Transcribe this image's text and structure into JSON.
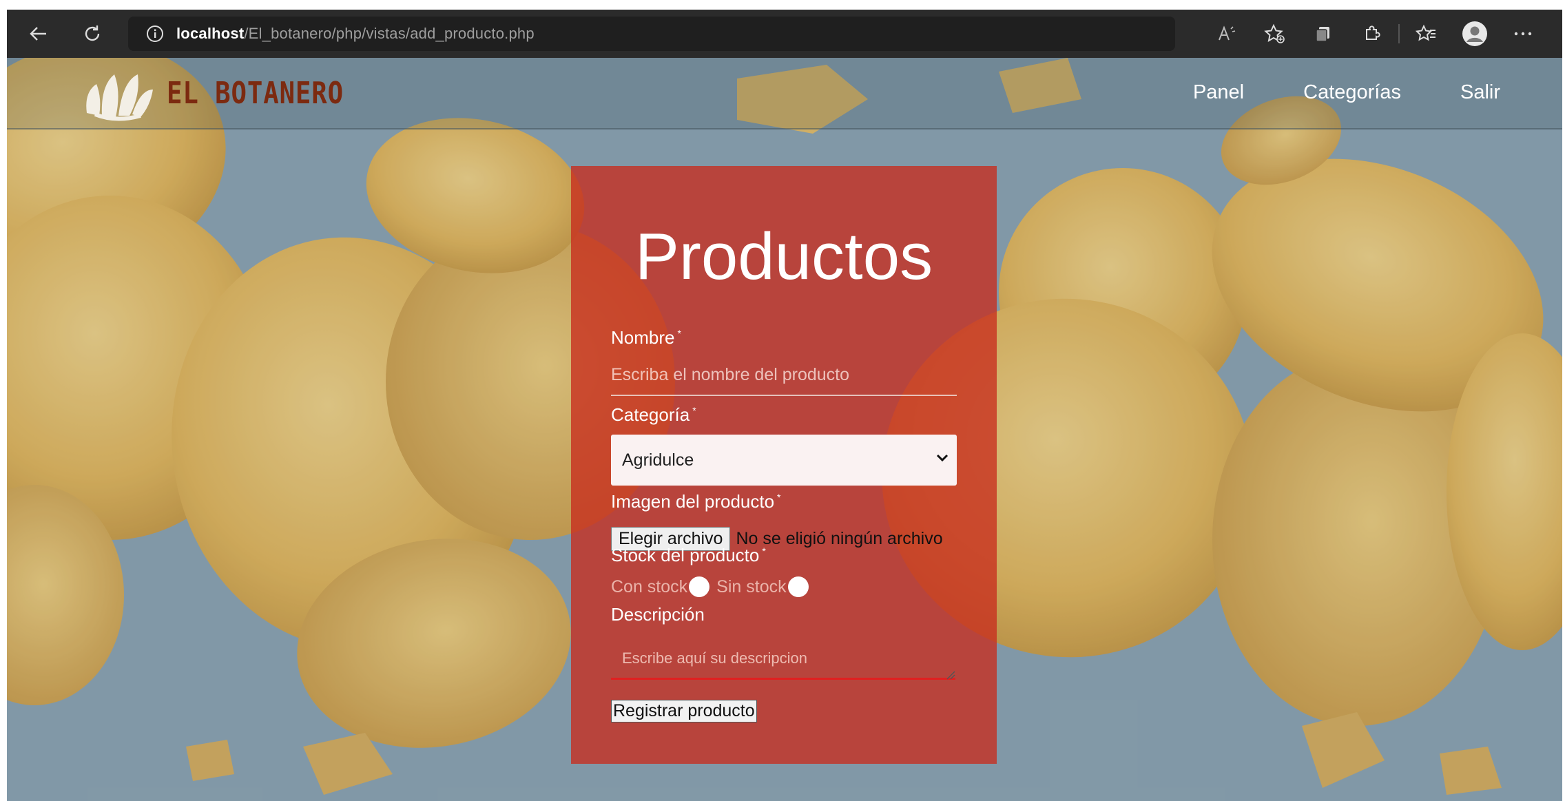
{
  "browser": {
    "url_host": "localhost",
    "url_path": "/El_botanero/php/vistas/add_producto.php"
  },
  "site": {
    "logo_text": "EL BOTANERO",
    "menu": [
      {
        "label": "Panel"
      },
      {
        "label": "Categorías"
      },
      {
        "label": "Salir"
      }
    ]
  },
  "form": {
    "title": "Productos",
    "nombre_label": "Nombre",
    "nombre_placeholder": "Escriba el nombre del producto",
    "categoria_label": "Categoría",
    "categoria_selected": "Agridulce",
    "imagen_label": "Imagen del producto",
    "file_button": "Elegir archivo",
    "file_status": "No se eligió ningún archivo",
    "stock_label": "Stock del producto",
    "stock_options": [
      {
        "label": "Con stock"
      },
      {
        "label": "Sin stock"
      }
    ],
    "descripcion_label": "Descripción",
    "descripcion_placeholder": "Escribe aquí su descripcion",
    "required_mark": "*",
    "submit_label": "Registrar producto"
  },
  "colors": {
    "browser_bar": "#2b2b2b",
    "card": "#c82d1e",
    "logo": "#7c2a10",
    "background": "#8ca4b2"
  }
}
